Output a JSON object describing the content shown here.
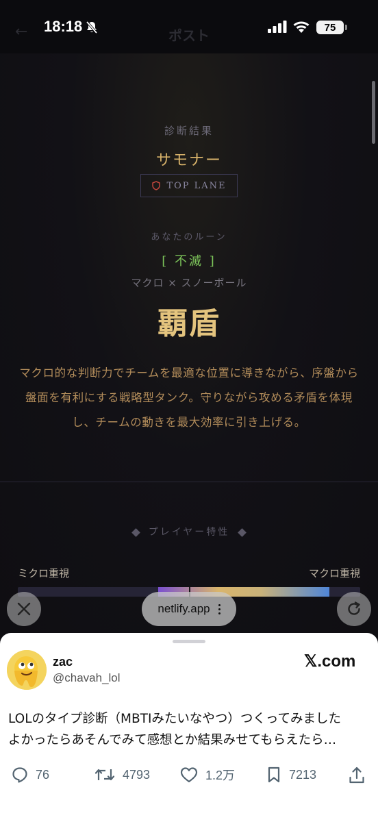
{
  "status_bar": {
    "time": "18:18",
    "battery": "75"
  },
  "app_header": {
    "back": "←",
    "title": "ポスト"
  },
  "result": {
    "label": "診断結果",
    "name": "サモナー",
    "lane": "TOP LANE"
  },
  "rune": {
    "label": "あなたのルーン",
    "name": "[ 不滅 ]",
    "combo": "マクロ × スノーボール",
    "title": "覇盾"
  },
  "description": "マクロ的な判断力でチームを最適な位置に導きながら、序盤から盤面を有利にする戦略型タンク。守りながら攻める矛盾を体現し、チームの動きを最大効率に引き上げる。",
  "traits": {
    "title": "プレイヤー特性",
    "bar": {
      "left_label": "ミクロ重視",
      "right_label": "マクロ重視",
      "fill_start": 0.41,
      "fill_end": 0.91,
      "marker": 0.5
    }
  },
  "browser": {
    "url": "netlify.app"
  },
  "post": {
    "user_name": "zac",
    "user_handle": "@chavah_lol",
    "source": "𝕏.com",
    "text_line1": "LOLのタイプ診断（MBTIみたいなやつ）つくってみました",
    "text_line2": "よかったらあそんでみて感想とか結果みせてもらえたら…",
    "replies": "76",
    "reposts": "4793",
    "likes": "1.2万",
    "bookmarks": "7213"
  },
  "colors": {
    "gold": "#d7b26a",
    "rune_green": "#7cc45a",
    "shield_red": "#c0463c"
  },
  "icons": [
    "bell-slash-icon",
    "signal-icon",
    "wifi-icon",
    "shield-icon",
    "close-icon",
    "reload-icon",
    "more-icon",
    "reply-icon",
    "repost-icon",
    "like-icon",
    "bookmark-icon",
    "share-icon"
  ]
}
